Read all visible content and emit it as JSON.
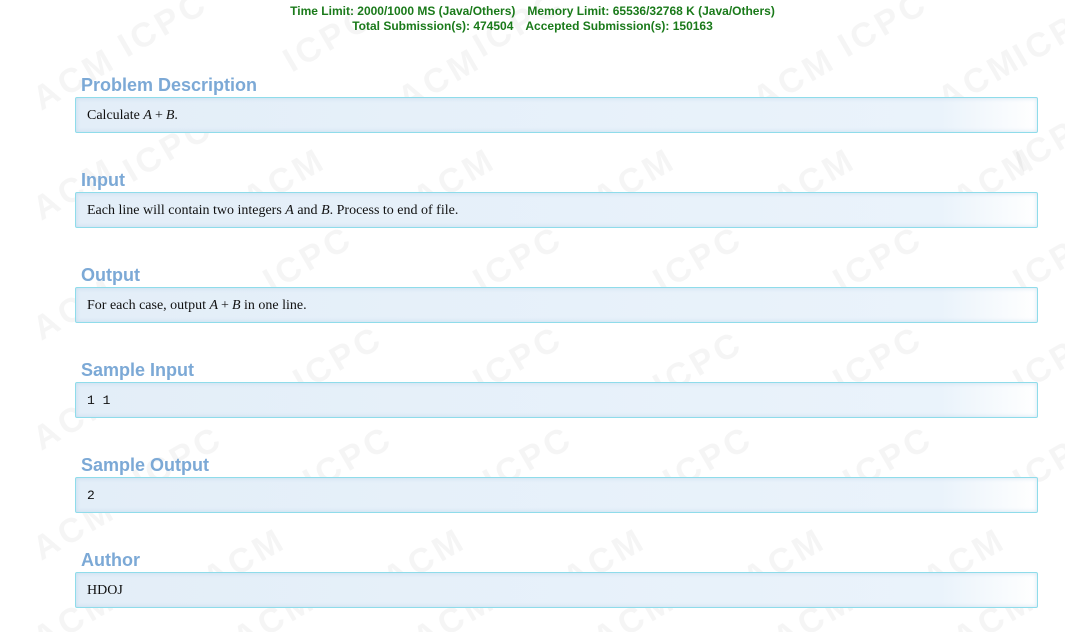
{
  "header": {
    "time_limit": "Time Limit: 2000/1000 MS (Java/Others)",
    "memory_limit": "Memory Limit: 65536/32768 K (Java/Others)",
    "total_submissions": "Total Submission(s): 474504",
    "accepted_submissions": "Accepted Submission(s): 150163"
  },
  "watermark": {
    "words": [
      "ACM",
      "ICPC"
    ]
  },
  "colors": {
    "limits_text": "#1a7a1a",
    "section_title": "#7ca9d6",
    "panel_border": "#8fdcea",
    "panel_bg": "#e3eef8"
  },
  "sections": {
    "problem_description": {
      "title": "Problem Description",
      "text_before": "Calculate ",
      "var_a": "A",
      "op": "+",
      "var_b": "B",
      "text_after": "."
    },
    "input": {
      "title": "Input",
      "text_1": "Each line will contain two integers ",
      "var_a": "A",
      "text_2": " and ",
      "var_b": "B",
      "text_3": ". Process to end of file."
    },
    "output": {
      "title": "Output",
      "text_1": "For each case, output ",
      "var_a": "A",
      "op": "+",
      "var_b": "B",
      "text_2": " in one line."
    },
    "sample_input": {
      "title": "Sample Input",
      "text": "1 1"
    },
    "sample_output": {
      "title": "Sample Output",
      "text": "2"
    },
    "author": {
      "title": "Author",
      "text": "HDOJ"
    }
  }
}
